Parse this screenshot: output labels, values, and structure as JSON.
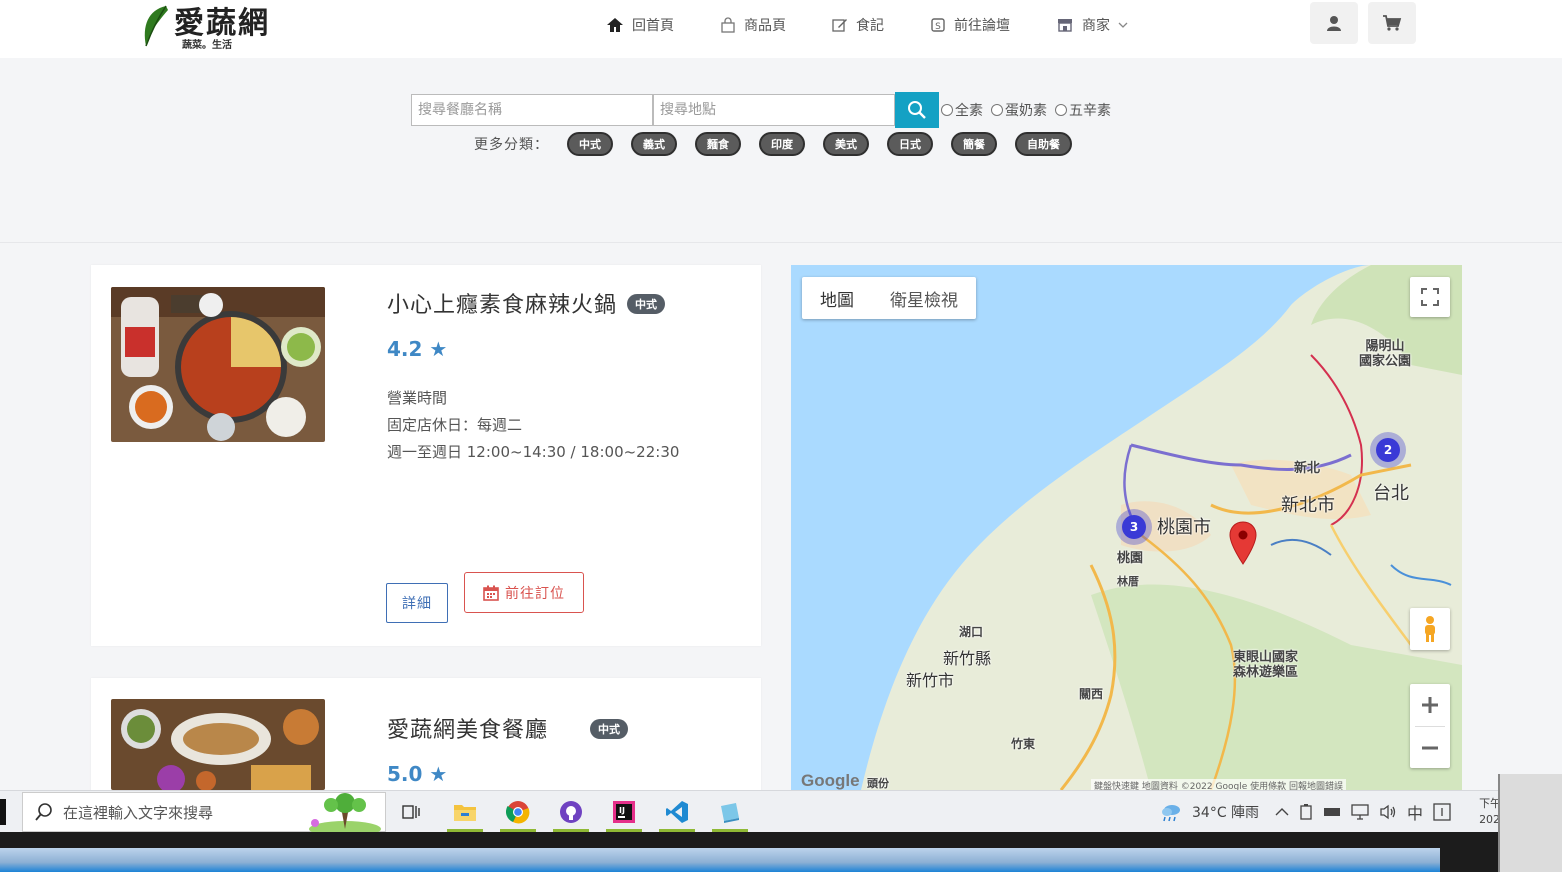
{
  "nav": {
    "logo": "愛蔬網",
    "logo_sub": "蔬菜。生活",
    "links": [
      "回首頁",
      "商品頁",
      "食記",
      "前往論壇",
      "商家"
    ]
  },
  "search": {
    "restaurant_placeholder": "搜尋餐廳名稱",
    "location_placeholder": "搜尋地點",
    "radio_options": [
      "全素",
      "蛋奶素",
      "五辛素"
    ]
  },
  "categories": {
    "label": "更多分類：",
    "items": [
      "中式",
      "義式",
      "麵食",
      "印度",
      "美式",
      "日式",
      "簡餐",
      "自助餐"
    ]
  },
  "restaurants": [
    {
      "name": "小心上癮素食麻辣火鍋",
      "badge": "中式",
      "rating": "4.2 ★",
      "hours_title": "營業時間",
      "closed_day": "固定店休日：每週二",
      "hours": "週一至週日 12:00~14:30 / 18:00~22:30",
      "detail_btn": "詳細",
      "book_btn": "前往訂位"
    },
    {
      "name": "愛蔬網美食餐廳",
      "badge": "中式",
      "rating": "5.0 ★"
    }
  ],
  "map": {
    "tab_map": "地圖",
    "tab_satellite": "衛星檢視",
    "labels": {
      "yangmingshan": "陽明山\n國家公園",
      "xinbei_small": "新北",
      "taipei": "台北",
      "xinbei_city": "新北市",
      "taoyuan_city": "桃園市",
      "taoyuan": "桃園",
      "linkou": "林厝",
      "hukou": "湖口",
      "hsinchu_county": "新竹縣",
      "hsinchu_city": "新竹市",
      "guanxi": "關西",
      "zhudong": "竹東",
      "dongyanshan": "東眼山國家\n森林遊樂區",
      "toufen": "頭份"
    },
    "clusters": [
      "3",
      "2"
    ],
    "google": "Google",
    "footer": "鍵盤快速鍵   地圖資料 ©2022 Google   使用條款   回報地圖錯誤"
  },
  "taskbar": {
    "search_placeholder": "在這裡輸入文字來搜尋",
    "weather": "34°C 陣雨",
    "ime": "中",
    "time_partial": "下午",
    "date_partial": "202"
  },
  "colors": {
    "accent": "#14a1c4",
    "book_red": "#d9534f",
    "rating_blue": "#3f88c5",
    "badge_gray": "#555d66"
  }
}
